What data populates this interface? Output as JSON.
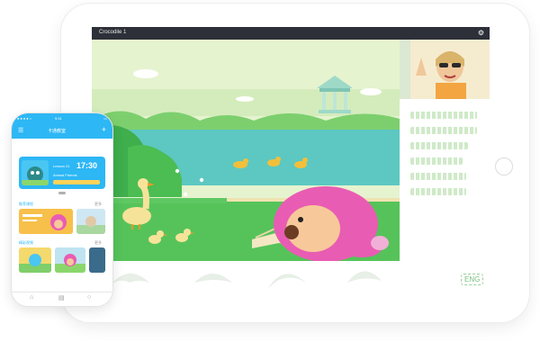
{
  "tablet": {
    "topbar_title": "Crocodile 1",
    "settings_icon": "gear-icon",
    "bottom_badge": "ENG",
    "text_line_widths": [
      0.86,
      0.86,
      0.74,
      0.68,
      0.72,
      0.72
    ]
  },
  "phone": {
    "app_name": "卡通教室",
    "status_time": "9:41",
    "lesson": {
      "date": "Lesson 21",
      "time": "17:30",
      "desc": "Animal Friends"
    },
    "sections": [
      {
        "title": "推荐课程",
        "more": "更多"
      },
      {
        "title": "精彩视频",
        "more": "更多"
      }
    ],
    "tabs": [
      "home-icon",
      "book-icon",
      "user-icon"
    ]
  },
  "colors": {
    "accent": "#2db7f5",
    "grass": "#56c35a",
    "water": "#59c9bf",
    "sky": "#dff1c8",
    "pink": "#e95cb3"
  }
}
